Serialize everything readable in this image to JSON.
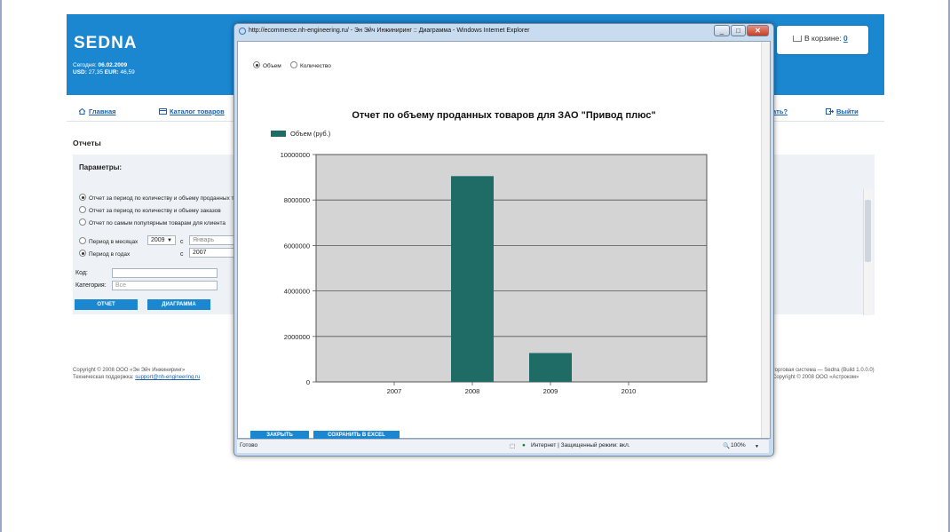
{
  "site": {
    "logo": "SEDNA",
    "today_label": "Сегодня:",
    "today_date": "06.02.2009",
    "usd_label": "USD:",
    "usd_value": "27,35",
    "eur_label": "EUR:",
    "eur_value": "46,59",
    "cart_label": "В корзине:",
    "cart_count": "0",
    "nav": {
      "home": "Главная",
      "catalog": "Каталог товаров",
      "help_partial": "ать?",
      "logout": "Выйти"
    },
    "page_title": "Отчеты",
    "params_title": "Параметры:",
    "report_options": [
      "Отчет за период по количеству и объему проданных то",
      "Отчет за период по количеству и объему заказов",
      "Отчет по самым популярным товарам для клиента"
    ],
    "period_months_label": "Период в месяцах",
    "period_years_label": "Период в годах",
    "year_select": "2009",
    "from_label_1": "с",
    "from_label_2": "с",
    "month_value": "Январь",
    "year_value": "2007",
    "code_label": "Код:",
    "category_label": "Категория:",
    "category_placeholder": "Все",
    "btn_report": "ОТЧЕТ",
    "btn_diagram": "ДИАГРАММА",
    "footer_left_1": "Copyright © 2008 ООО «Эн Эйч Инжиниринг»",
    "footer_left_2_prefix": "Техническая поддержка:",
    "footer_left_2_link": "support@nh-engineering.ru",
    "footer_right_1": "торговая система — Sedna (Build 1.0.0.0)",
    "footer_right_2": "Copyright © 2008 ООО «Астроком»"
  },
  "popup": {
    "window_title": "http://ecommerce.nh-engineering.ru/ - Эн Эйч Инжиниринг :: Диаграмма - Windows Internet Explorer",
    "radio_volume": "Объем",
    "radio_quantity": "Количество",
    "btn_close": "ЗАКРЫТЬ",
    "btn_excel": "СОХРАНИТЬ В EXCEL",
    "status_ready": "Готово",
    "status_zone": "Интернет | Защищенный режим: вкл.",
    "zoom": "100%"
  },
  "chart_data": {
    "type": "bar",
    "title": "Отчет по объему проданных товаров для ЗАО \"Привод плюс\"",
    "categories": [
      "2007",
      "2008",
      "2009",
      "2010"
    ],
    "series": [
      {
        "name": "Объем (руб.)",
        "values": [
          0,
          9050000,
          1270000,
          0
        ]
      }
    ],
    "ylim": [
      0,
      10000000
    ],
    "yticks": [
      "10000000",
      "8000000",
      "6000000",
      "4000000",
      "2000000",
      "0"
    ],
    "grid": true,
    "legend": "top-left",
    "bar_color": "#1f6b66",
    "plot_background": "#d4d4d4"
  }
}
